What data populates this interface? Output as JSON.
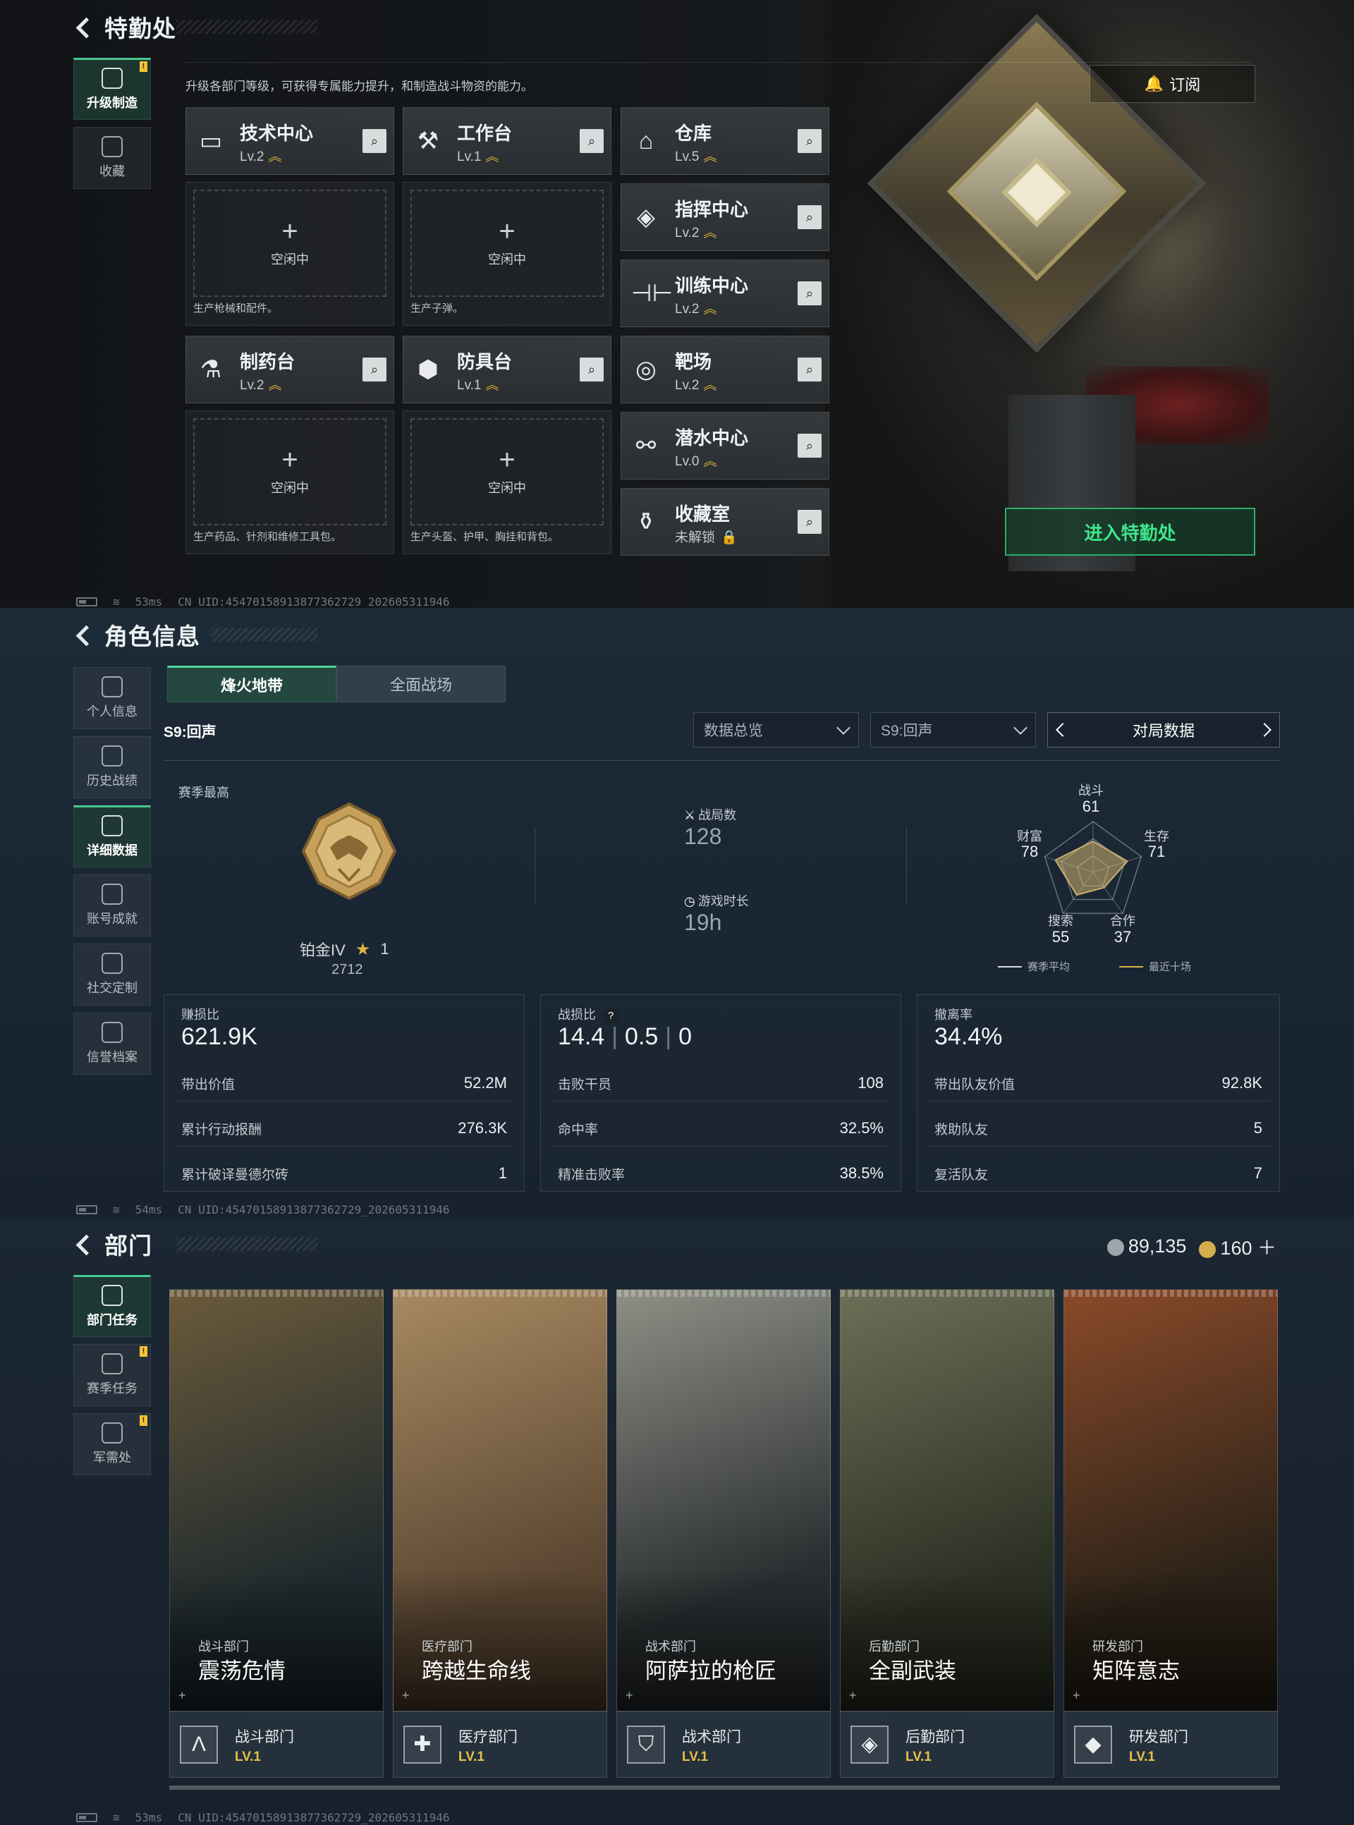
{
  "panel1": {
    "title": "特勤处",
    "sidebar": [
      {
        "label": "升级制造",
        "active": true,
        "badge": "!"
      },
      {
        "label": "收藏",
        "active": false,
        "badge": ""
      }
    ],
    "description": "升级各部门等级，可获得专属能力提升，和制造战斗物资的能力。",
    "subscribe_label": "订阅",
    "enter_label": "进入特勤处",
    "workshops": [
      {
        "name": "技术中心",
        "level": "Lv.2",
        "icon": "monitor-icon",
        "slot_idle": "空闲中",
        "slot_desc": "生产枪械和配件。"
      },
      {
        "name": "工作台",
        "level": "Lv.1",
        "icon": "tools-icon",
        "slot_idle": "空闲中",
        "slot_desc": "生产子弹。"
      },
      {
        "name": "制药台",
        "level": "Lv.2",
        "icon": "microscope-icon",
        "slot_idle": "空闲中",
        "slot_desc": "生产药品、针剂和维修工具包。"
      },
      {
        "name": "防具台",
        "level": "Lv.1",
        "icon": "armor-icon",
        "slot_idle": "空闲中",
        "slot_desc": "生产头盔、护甲、胸挂和背包。"
      }
    ],
    "facilities": [
      {
        "name": "仓库",
        "level": "Lv.5",
        "icon": "warehouse-icon"
      },
      {
        "name": "指挥中心",
        "level": "Lv.2",
        "icon": "command-icon"
      },
      {
        "name": "训练中心",
        "level": "Lv.2",
        "icon": "dumbbell-icon"
      },
      {
        "name": "靶场",
        "level": "Lv.2",
        "icon": "target-icon"
      },
      {
        "name": "潜水中心",
        "level": "Lv.0",
        "icon": "diving-mask-icon"
      },
      {
        "name": "收藏室",
        "level": "未解锁",
        "icon": "collection-icon"
      }
    ],
    "footer": {
      "ping": "53ms",
      "uid": "CN UID:4547015891387736272​9_202605311946"
    }
  },
  "panel2": {
    "title": "角色信息",
    "sidebar": [
      {
        "label": "个人信息",
        "active": false
      },
      {
        "label": "历史战绩",
        "active": false
      },
      {
        "label": "详细数据",
        "active": true
      },
      {
        "label": "账号成就",
        "active": false
      },
      {
        "label": "社交定制",
        "active": false
      },
      {
        "label": "信誉档案",
        "active": false
      }
    ],
    "tabs": [
      {
        "label": "烽火地带",
        "active": true
      },
      {
        "label": "全面战场",
        "active": false
      }
    ],
    "season": "S9:回声",
    "dropdown1": "数据总览",
    "dropdown2": "S9:回声",
    "nav_label": "对局数据",
    "season_best_label": "赛季最高",
    "rank_name": "铂金IV",
    "rank_stars": "1",
    "rank_score": "2712",
    "matches_label": "战局数",
    "matches_value": "128",
    "playtime_label": "游戏时长",
    "playtime_value": "19h",
    "radar": {
      "axes": [
        {
          "label": "战斗",
          "value": "61"
        },
        {
          "label": "生存",
          "value": "71"
        },
        {
          "label": "合作",
          "value": "37"
        },
        {
          "label": "搜索",
          "value": "55"
        },
        {
          "label": "财富",
          "value": "78"
        }
      ],
      "legend_avg": "赛季平均",
      "legend_recent": "最近十场"
    },
    "box1": {
      "head": "赚损比",
      "big": "621.9K",
      "rows": [
        [
          "带出价值",
          "52.2M"
        ],
        [
          "累计行动报酬",
          "276.3K"
        ],
        [
          "累计破译曼德尔砖",
          "1"
        ]
      ]
    },
    "box2": {
      "head": "战损比",
      "big1": "14.4",
      "big2": "0.5",
      "big3": "0",
      "rows": [
        [
          "击败干员",
          "108"
        ],
        [
          "命中率",
          "32.5%"
        ],
        [
          "精准击败率",
          "38.5%"
        ]
      ]
    },
    "box3": {
      "head": "撤离率",
      "big": "34.4%",
      "rows": [
        [
          "带出队友价值",
          "92.8K"
        ],
        [
          "救助队友",
          "5"
        ],
        [
          "复活队友",
          "7"
        ]
      ]
    },
    "footer": {
      "ping": "54ms",
      "uid": "CN UID:4547015891387736272​9_202605311946"
    }
  },
  "panel3": {
    "title": "部门",
    "sidebar": [
      {
        "label": "部门任务",
        "active": true,
        "badge": ""
      },
      {
        "label": "赛季任务",
        "active": false,
        "badge": "!"
      },
      {
        "label": "军需处",
        "active": false,
        "badge": "!"
      }
    ],
    "currency1": "89,135",
    "currency2": "160",
    "departments": [
      {
        "category": "战斗部门",
        "name": "震荡危情",
        "bar_name": "战斗部门",
        "level": "LV.1",
        "icon": "combat-dept-icon",
        "c1": "#1f2a2e",
        "c2": "#6b5a3a"
      },
      {
        "category": "医疗部门",
        "name": "跨越生命线",
        "bar_name": "医疗部门",
        "level": "LV.1",
        "icon": "medical-dept-icon",
        "c1": "#5a4632",
        "c2": "#a88a62"
      },
      {
        "category": "战术部门",
        "name": "阿萨拉的枪匠",
        "bar_name": "战术部门",
        "level": "LV.1",
        "icon": "tactical-dept-icon",
        "c1": "#2a2e30",
        "c2": "#8e9086"
      },
      {
        "category": "后勤部门",
        "name": "全副武装",
        "bar_name": "后勤部门",
        "level": "LV.1",
        "icon": "logistics-dept-icon",
        "c1": "#2c3024",
        "c2": "#6d6f56"
      },
      {
        "category": "研发部门",
        "name": "矩阵意志",
        "bar_name": "研发部门",
        "level": "LV.1",
        "icon": "rnd-dept-icon",
        "c1": "#2a2218",
        "c2": "#8a4a2a"
      }
    ],
    "footer": {
      "ping": "53ms",
      "uid": "CN UID:4547015891387736272​9_202605311946"
    }
  }
}
